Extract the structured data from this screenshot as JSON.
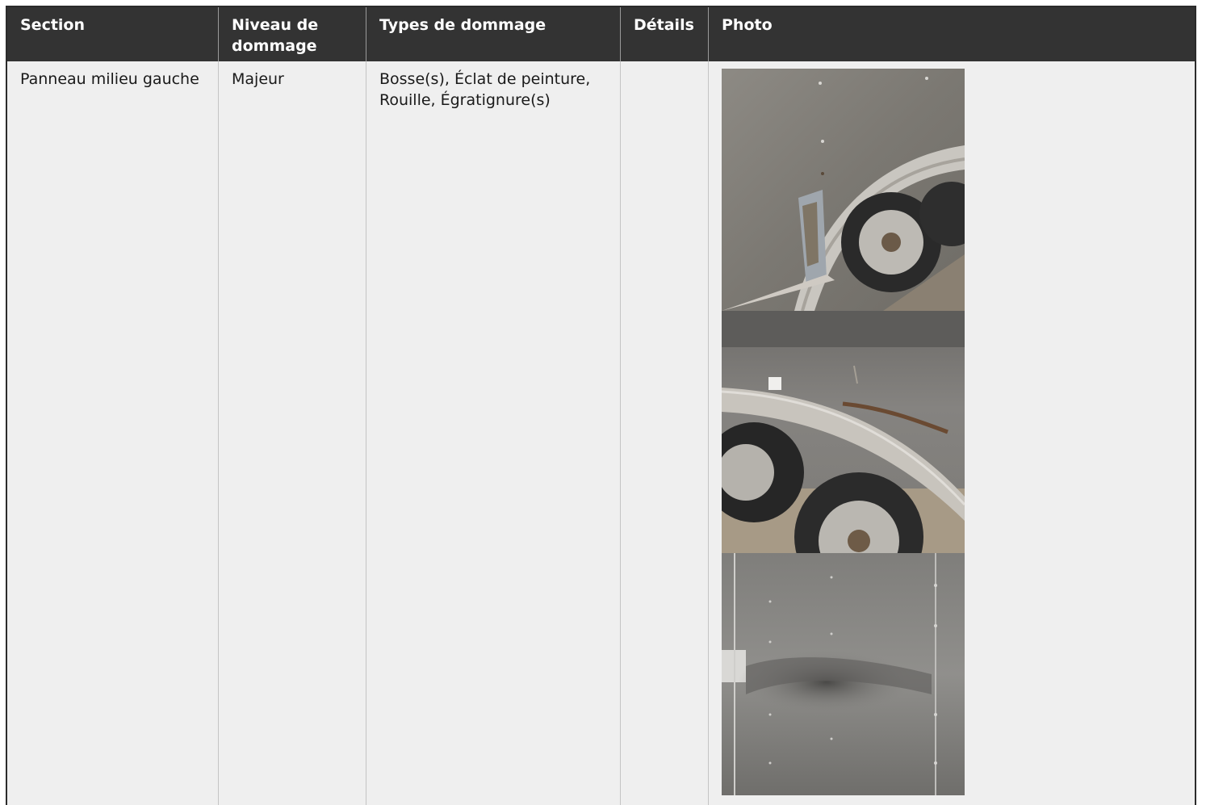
{
  "table": {
    "headers": {
      "section": "Section",
      "niveau": "Niveau de dommage",
      "types": "Types de dommage",
      "details": "Détails",
      "photo": "Photo"
    },
    "rows": [
      {
        "section": "Panneau milieu gauche",
        "niveau": "Majeur",
        "types": "Bosse(s), Éclat de peinture, Rouille, Égratignure(s)",
        "details": "",
        "photos": [
          "photo-damage-fender-rust",
          "photo-trailer-wheels-fender",
          "photo-dented-panel"
        ]
      }
    ]
  }
}
